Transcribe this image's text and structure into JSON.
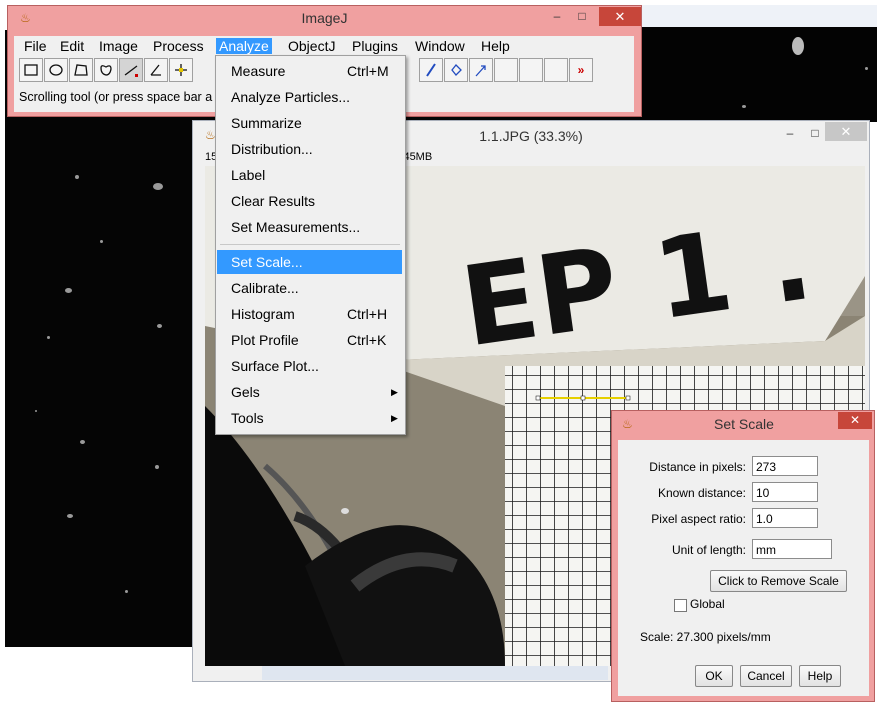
{
  "imagej": {
    "title": "ImageJ",
    "minimize": "–",
    "maximize": "□",
    "close": "✕",
    "menus": [
      "File",
      "Edit",
      "Image",
      "Process",
      "Analyze",
      "ObjectJ",
      "Plugins",
      "Window",
      "Help"
    ],
    "status": "Scrolling tool (or press space bar a",
    "toolbar_more": "»",
    "icons": [
      "rectangle-icon",
      "oval-icon",
      "polygon-icon",
      "freehand-icon",
      "line-icon",
      "angle-icon",
      "point-icon",
      "wand-icon",
      "dropper-icon",
      "pencil-icon",
      "brush-icon",
      "flood-fill-icon",
      "arrow-icon"
    ]
  },
  "image_window": {
    "title": "1.1.JPG (33.3%)",
    "info_left": "15",
    "info_right": "B; 45MB",
    "photo_text": "EP 1 ."
  },
  "analyze_menu": {
    "items": [
      {
        "label": "Measure",
        "shortcut": "Ctrl+M"
      },
      {
        "label": "Analyze Particles...",
        "shortcut": ""
      },
      {
        "label": "Summarize",
        "shortcut": ""
      },
      {
        "label": "Distribution...",
        "shortcut": ""
      },
      {
        "label": "Label",
        "shortcut": ""
      },
      {
        "label": "Clear Results",
        "shortcut": ""
      },
      {
        "label": "Set Measurements...",
        "shortcut": ""
      },
      {
        "label": "Set Scale...",
        "shortcut": ""
      },
      {
        "label": "Calibrate...",
        "shortcut": ""
      },
      {
        "label": "Histogram",
        "shortcut": "Ctrl+H"
      },
      {
        "label": "Plot Profile",
        "shortcut": "Ctrl+K"
      },
      {
        "label": "Surface Plot...",
        "shortcut": ""
      },
      {
        "label": "Gels",
        "shortcut": ""
      },
      {
        "label": "Tools",
        "shortcut": ""
      }
    ]
  },
  "set_scale": {
    "title": "Set Scale",
    "close": "✕",
    "distance_label": "Distance in pixels:",
    "distance_value": "273",
    "known_label": "Known distance:",
    "known_value": "10",
    "aspect_label": "Pixel aspect ratio:",
    "aspect_value": "1.0",
    "unit_label": "Unit of length:",
    "unit_value": "mm",
    "remove_button": "Click to Remove Scale",
    "global_label": "Global",
    "scale_text": "Scale: 27.300 pixels/mm",
    "ok": "OK",
    "cancel": "Cancel",
    "help": "Help"
  },
  "colors": {
    "window_frame": "#f0a0a0",
    "highlight": "#3399ff",
    "close_red": "#c7463a"
  }
}
